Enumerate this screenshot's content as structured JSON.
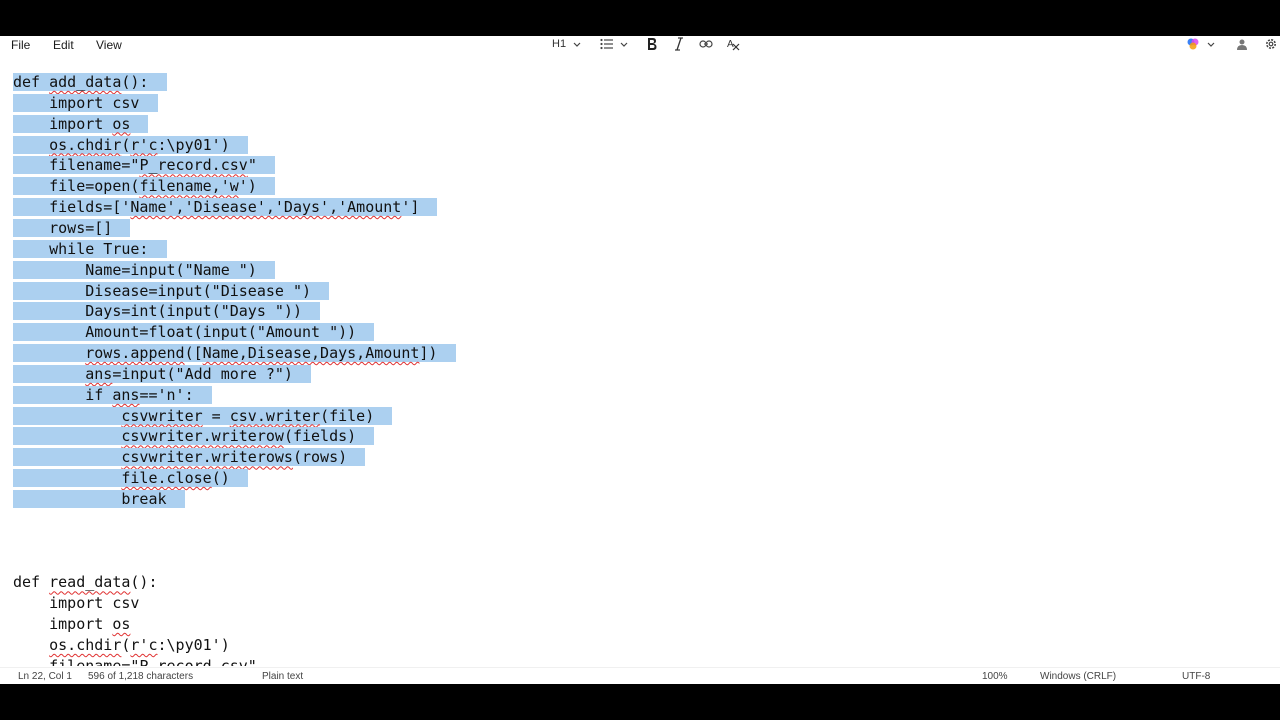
{
  "menu": {
    "file": "File",
    "edit": "Edit",
    "view": "View"
  },
  "toolbar": {
    "heading": "H1"
  },
  "code_lines": [
    {
      "parts": [
        {
          "t": "def "
        },
        {
          "t": "add_data",
          "sq": true
        },
        {
          "t": "():"
        }
      ],
      "sel": true
    },
    {
      "parts": [
        {
          "t": "    import csv"
        }
      ],
      "sel": true
    },
    {
      "parts": [
        {
          "t": "    import "
        },
        {
          "t": "os",
          "sq": true
        }
      ],
      "sel": true
    },
    {
      "parts": [
        {
          "t": "    "
        },
        {
          "t": "os.chdir",
          "sq": true
        },
        {
          "t": "("
        },
        {
          "t": "r'c",
          "sq": true
        },
        {
          "t": ":\\py01')"
        }
      ],
      "sel": true
    },
    {
      "parts": [
        {
          "t": "    filename=\""
        },
        {
          "t": "P_record.csv",
          "sq": true
        },
        {
          "t": "\""
        }
      ],
      "sel": true
    },
    {
      "parts": [
        {
          "t": "    file=open("
        },
        {
          "t": "filename,'w",
          "sq": true
        },
        {
          "t": "')"
        }
      ],
      "sel": true
    },
    {
      "parts": [
        {
          "t": "    fields=['"
        },
        {
          "t": "Name','Disease','Days','Amount",
          "sq": true
        },
        {
          "t": "']"
        }
      ],
      "sel": true
    },
    {
      "parts": [
        {
          "t": "    rows=[]"
        }
      ],
      "sel": true
    },
    {
      "parts": [
        {
          "t": "    while True:"
        }
      ],
      "sel": true
    },
    {
      "parts": [
        {
          "t": "        Name=input(\"Name \")"
        }
      ],
      "sel": true
    },
    {
      "parts": [
        {
          "t": "        Disease=input(\"Disease \")"
        }
      ],
      "sel": true
    },
    {
      "parts": [
        {
          "t": "        Days=int(input(\"Days \"))"
        }
      ],
      "sel": true
    },
    {
      "parts": [
        {
          "t": "        Amount=float(input(\"Amount \"))"
        }
      ],
      "sel": true
    },
    {
      "parts": [
        {
          "t": "        "
        },
        {
          "t": "rows.append",
          "sq": true
        },
        {
          "t": "(["
        },
        {
          "t": "Name,Disease,Days,Amount",
          "sq": true
        },
        {
          "t": "])"
        }
      ],
      "sel": true
    },
    {
      "parts": [
        {
          "t": "        "
        },
        {
          "t": "ans",
          "sq": true
        },
        {
          "t": "=input(\"Add more ?\")"
        }
      ],
      "sel": true
    },
    {
      "parts": [
        {
          "t": "        if "
        },
        {
          "t": "ans",
          "sq": true
        },
        {
          "t": "=='n':"
        }
      ],
      "sel": true
    },
    {
      "parts": [
        {
          "t": "            "
        },
        {
          "t": "csvwriter",
          "sq": true
        },
        {
          "t": " = "
        },
        {
          "t": "csv.writer",
          "sq": true
        },
        {
          "t": "(file)"
        }
      ],
      "sel": true
    },
    {
      "parts": [
        {
          "t": "            "
        },
        {
          "t": "csvwriter.writerow",
          "sq": true
        },
        {
          "t": "(fields)"
        }
      ],
      "sel": true
    },
    {
      "parts": [
        {
          "t": "            "
        },
        {
          "t": "csvwriter.writerows",
          "sq": true
        },
        {
          "t": "(rows)"
        }
      ],
      "sel": true
    },
    {
      "parts": [
        {
          "t": "            "
        },
        {
          "t": "file.close",
          "sq": true
        },
        {
          "t": "()"
        }
      ],
      "sel": true
    },
    {
      "parts": [
        {
          "t": "            break"
        }
      ],
      "sel": true
    },
    {
      "parts": [
        {
          "t": ""
        }
      ],
      "sel": false
    },
    {
      "parts": [
        {
          "t": ""
        }
      ],
      "sel": false
    },
    {
      "parts": [
        {
          "t": ""
        }
      ],
      "sel": false
    },
    {
      "parts": [
        {
          "t": "def "
        },
        {
          "t": "read_data",
          "sq": true
        },
        {
          "t": "():"
        }
      ],
      "sel": false
    },
    {
      "parts": [
        {
          "t": "    import csv"
        }
      ],
      "sel": false
    },
    {
      "parts": [
        {
          "t": "    import "
        },
        {
          "t": "os",
          "sq": true
        }
      ],
      "sel": false
    },
    {
      "parts": [
        {
          "t": "    "
        },
        {
          "t": "os.chdir",
          "sq": true
        },
        {
          "t": "("
        },
        {
          "t": "r'c",
          "sq": true
        },
        {
          "t": ":\\py01')"
        }
      ],
      "sel": false
    },
    {
      "parts": [
        {
          "t": "    filename=\"P_record.csv\""
        }
      ],
      "sel": false
    }
  ],
  "status": {
    "position": "Ln 22, Col 1",
    "count": "596 of 1,218 characters",
    "format": "Plain text",
    "zoom": "100%",
    "line_ending": "Windows (CRLF)",
    "encoding": "UTF-8"
  }
}
